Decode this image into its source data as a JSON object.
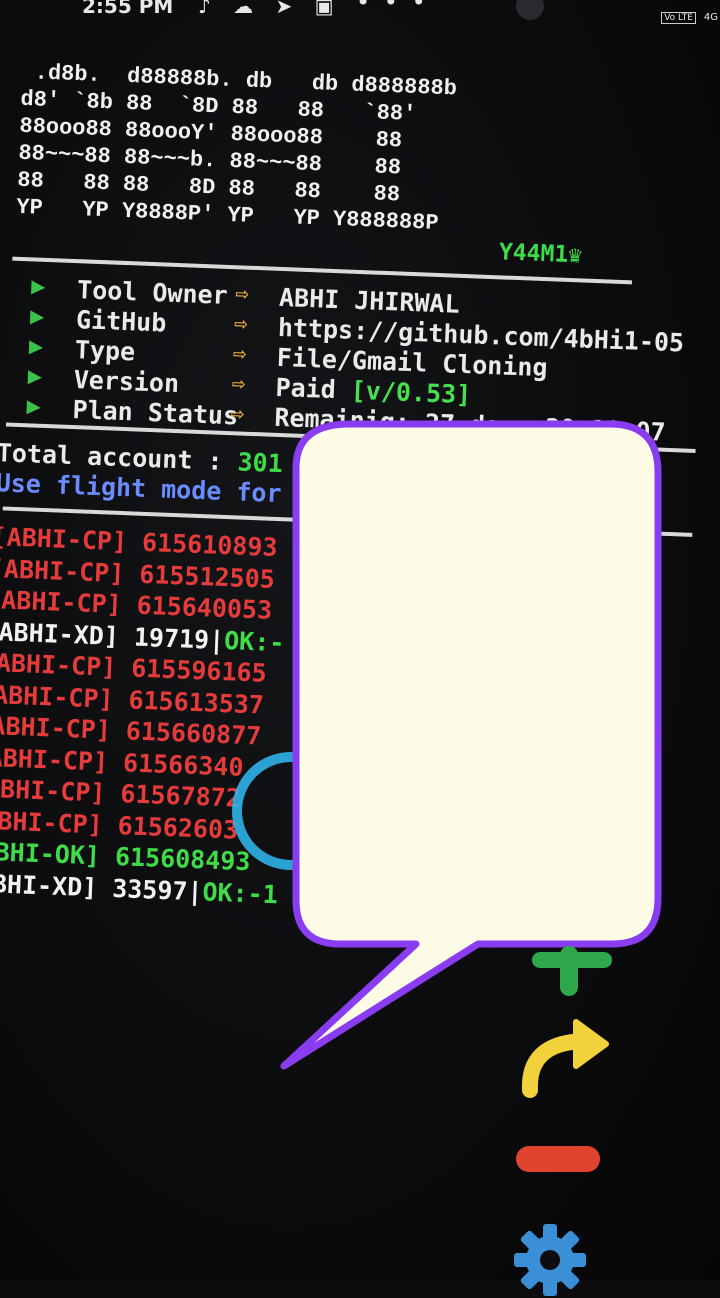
{
  "status_bar": {
    "time": "2:55 PM",
    "icons": "♪ ☁ ➤ ▣",
    "dots": "• • •",
    "network": "Vo LTE",
    "signal": "4G"
  },
  "banner": {
    "ascii_art": " .d8b.  d88888b. db   db d888888b\nd8' `8b 88  `8D 88   88   `88'\n88ooo88 88oooY' 88ooo88    88\n88~~~88 88~~~b. 88~~~88    88\n88   88 88   8D 88   88    88\nYP   YP Y8888P' YP   YP Y888888P",
    "tag": "Y44M1♛"
  },
  "info": [
    {
      "key": "Tool Owner",
      "value": "ABHI JHIRWAL",
      "extra": ""
    },
    {
      "key": "GitHub",
      "value": "https://github.com/4bHi1-05",
      "extra": ""
    },
    {
      "key": "Type",
      "value": "File/Gmail Cloning",
      "extra": ""
    },
    {
      "key": "Version",
      "value": "Paid ",
      "extra": "[v/0.53]"
    },
    {
      "key": "Plan Status",
      "value": "Remainig: 27 days  20:18:07",
      "extra": ""
    }
  ],
  "info_arrow": "⇨",
  "summary": {
    "total_label": "Total account : ",
    "total_value": "301",
    "flight_text": "Use flight mode for"
  },
  "log": [
    {
      "kind": "cp",
      "tag": "[ABHI-CP]",
      "rest": " 615610893",
      "ok": ""
    },
    {
      "kind": "cp",
      "tag": "[ABHI-CP]",
      "rest": " 615512505",
      "ok": ""
    },
    {
      "kind": "cp",
      "tag": "[ABHI-CP]",
      "rest": " 615640053",
      "ok": ""
    },
    {
      "kind": "xd",
      "tag": "[ABHI-XD]",
      "rest": " 19719|",
      "ok": "OK:-"
    },
    {
      "kind": "cp",
      "tag": "[ABHI-CP]",
      "rest": " 615596165",
      "ok": ""
    },
    {
      "kind": "cp",
      "tag": "[ABHI-CP]",
      "rest": " 615613537",
      "ok": ""
    },
    {
      "kind": "cp",
      "tag": "[ABHI-CP]",
      "rest": " 615660877",
      "ok": ""
    },
    {
      "kind": "cp",
      "tag": "[ABHI-CP]",
      "rest": " 61566340",
      "ok": ""
    },
    {
      "kind": "cp",
      "tag": "[ABHI-CP]",
      "rest": " 61567872",
      "ok": ""
    },
    {
      "kind": "cp",
      "tag": "[ABHI-CP]",
      "rest": " 61562603",
      "ok": ""
    },
    {
      "kind": "ok",
      "tag": "[ABHI-OK]",
      "rest": " 615608493",
      "ok": ""
    },
    {
      "kind": "xd",
      "tag": "[ABHI-XD]",
      "rest": " 33597|",
      "ok": "OK:-1"
    }
  ],
  "colors": {
    "terminal_bg": "#0d0d0f",
    "green": "#3fdc4a",
    "red": "#e53b3b",
    "blue_text": "#6b8cff",
    "bubble_fill": "#fefce6",
    "bubble_stroke": "#8a3df0",
    "plus": "#2ea84a",
    "redo": "#f2d23a",
    "minus": "#e0442f",
    "gear": "#3b8fd6"
  },
  "controls": {
    "add_icon": "plus-icon",
    "redo_icon": "redo-arrow-icon",
    "remove_icon": "minus-icon",
    "settings_icon": "gear-icon"
  }
}
